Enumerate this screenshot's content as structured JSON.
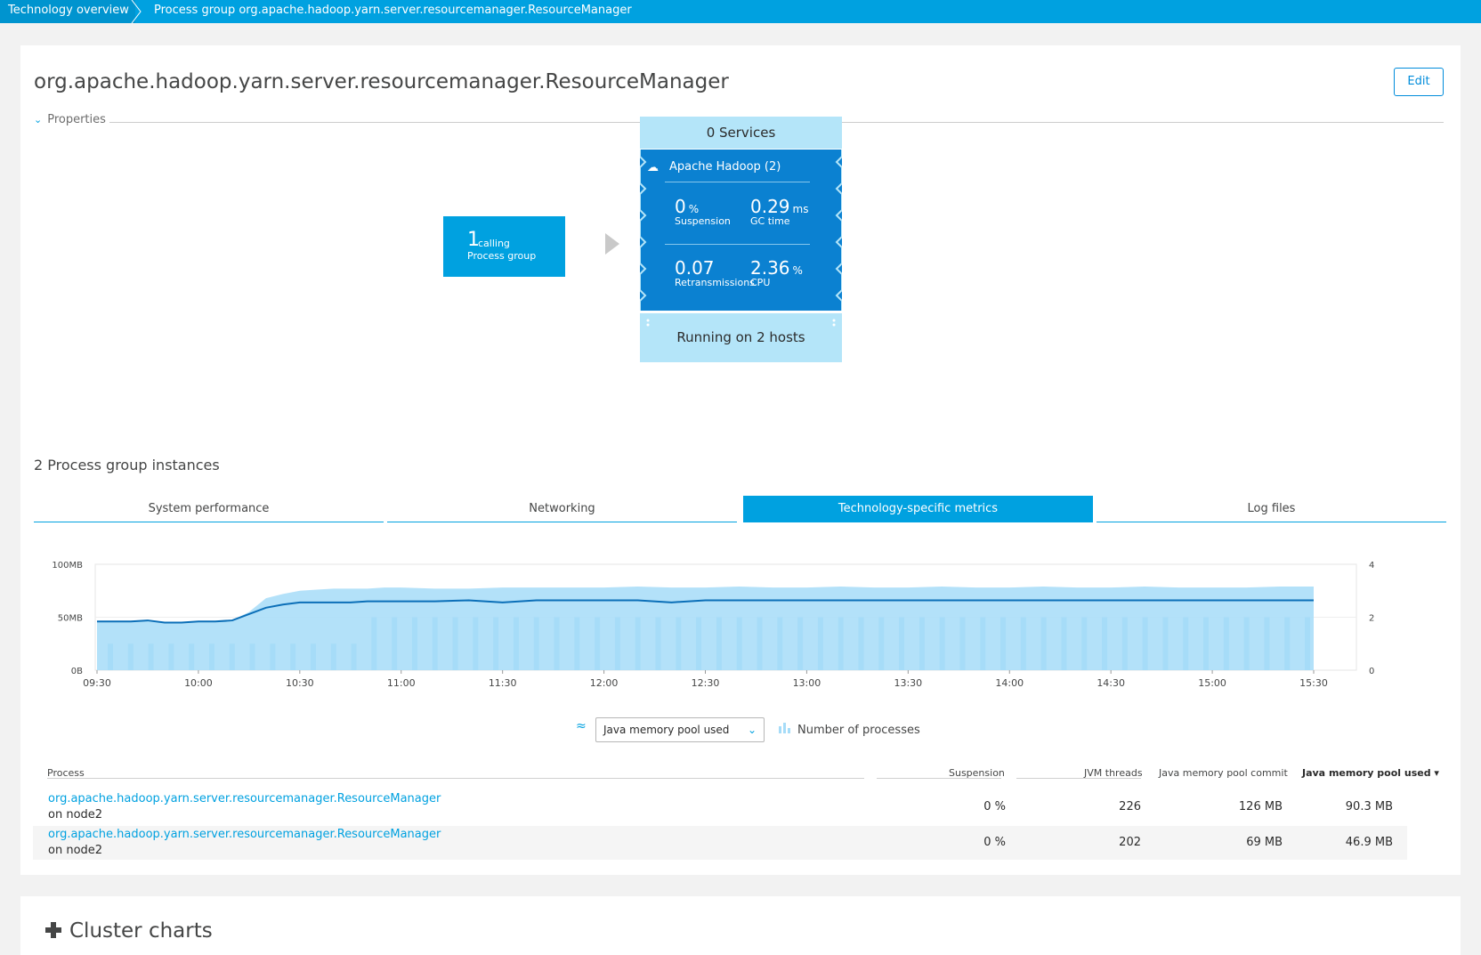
{
  "breadcrumb": {
    "items": [
      {
        "label": "Technology overview"
      },
      {
        "label": "Process group org.apache.hadoop.yarn.server.resourcemanager.ResourceManager"
      }
    ]
  },
  "header": {
    "title": "org.apache.hadoop.yarn.server.resourcemanager.ResourceManager",
    "edit_label": "Edit",
    "properties_label": "Properties"
  },
  "topology": {
    "caller": {
      "count": "1",
      "line1": "calling",
      "line2": "Process group"
    },
    "services_label": "0 Services",
    "process_group": {
      "name": "Apache Hadoop (2)",
      "icon": "hadoop-elephant-icon",
      "metrics": [
        {
          "value": "0",
          "unit": "%",
          "label": "Suspension"
        },
        {
          "value": "0.29",
          "unit": "ms",
          "label": "GC time"
        },
        {
          "value": "0.07",
          "unit": "",
          "label": "Retransmissions"
        },
        {
          "value": "2.36",
          "unit": "%",
          "label": "CPU"
        }
      ]
    },
    "hosts_label": "Running on 2 hosts"
  },
  "instances": {
    "title": "2 Process group instances",
    "tabs": [
      {
        "label": "System performance",
        "active": false
      },
      {
        "label": "Networking",
        "active": false
      },
      {
        "label": "Technology-specific metrics",
        "active": true
      },
      {
        "label": "Log files",
        "active": false
      }
    ]
  },
  "chart_data": {
    "type": "area",
    "x": [
      "09:30",
      "09:35",
      "09:40",
      "09:45",
      "09:50",
      "09:55",
      "10:00",
      "10:05",
      "10:10",
      "10:15",
      "10:20",
      "10:25",
      "10:30",
      "10:35",
      "10:40",
      "10:45",
      "10:50",
      "10:55",
      "11:00",
      "11:10",
      "11:20",
      "11:30",
      "11:40",
      "11:50",
      "12:00",
      "12:10",
      "12:20",
      "12:30",
      "12:40",
      "12:50",
      "13:00",
      "13:10",
      "13:20",
      "13:30",
      "13:40",
      "13:50",
      "14:00",
      "14:10",
      "14:20",
      "14:30",
      "14:40",
      "14:50",
      "15:00",
      "15:10",
      "15:20",
      "15:30"
    ],
    "series": [
      {
        "name": "Java memory pool commit",
        "axis": "left",
        "values": [
          46,
          46,
          46,
          47,
          45,
          45,
          46,
          46,
          47,
          55,
          68,
          72,
          75,
          76,
          77,
          77,
          77,
          78,
          78,
          77,
          77,
          78,
          78,
          78,
          78,
          79,
          78,
          78,
          79,
          78,
          78,
          79,
          78,
          78,
          79,
          78,
          78,
          79,
          78,
          78,
          79,
          78,
          78,
          78,
          79,
          79
        ]
      },
      {
        "name": "Java memory pool used",
        "axis": "left",
        "values": [
          46,
          46,
          46,
          47,
          45,
          45,
          46,
          46,
          47,
          53,
          59,
          62,
          64,
          64,
          64,
          64,
          65,
          65,
          65,
          65,
          66,
          64,
          66,
          66,
          66,
          66,
          64,
          66,
          66,
          66,
          66,
          66,
          66,
          66,
          66,
          66,
          66,
          66,
          66,
          66,
          66,
          66,
          66,
          66,
          66,
          66
        ]
      },
      {
        "name": "Number of processes",
        "axis": "right",
        "type": "bar",
        "values": [
          1,
          1,
          1,
          1,
          1,
          1,
          1,
          1,
          1,
          1,
          2,
          2,
          2,
          2,
          2,
          2,
          2,
          2,
          2,
          2,
          2,
          2,
          2,
          2,
          2,
          2,
          2,
          2,
          2,
          2,
          2,
          2,
          2,
          2,
          2,
          2,
          2,
          2,
          2,
          2,
          2,
          2,
          2,
          2,
          2,
          2
        ]
      }
    ],
    "x_ticks": [
      "09:30",
      "10:00",
      "10:30",
      "11:00",
      "11:30",
      "12:00",
      "12:30",
      "13:00",
      "13:30",
      "14:00",
      "14:30",
      "15:00",
      "15:30"
    ],
    "y_ticks_left": [
      "100MB",
      "50MB",
      "0B"
    ],
    "y_ticks_right": [
      "4",
      "2",
      "0"
    ],
    "ylim_left": [
      0,
      100
    ],
    "ylim_right": [
      0,
      4
    ],
    "selector_label": "Java memory pool used",
    "bars_legend_label": "Number of processes",
    "colors": {
      "area": "#a6dcf8",
      "line": "#0b6fb8",
      "bars": "#a6dcf8"
    }
  },
  "table": {
    "columns": [
      "Process",
      "Suspension",
      "JVM threads",
      "Java memory pool commit",
      "Java memory pool used ▾"
    ],
    "rows": [
      {
        "process": "org.apache.hadoop.yarn.server.resourcemanager.ResourceManager",
        "host": "on node2",
        "suspension": "0 %",
        "threads": "226",
        "commit": "126 MB",
        "used": "90.3 MB"
      },
      {
        "process": "org.apache.hadoop.yarn.server.resourcemanager.ResourceManager",
        "host": "on node2",
        "suspension": "0 %",
        "threads": "202",
        "commit": "69 MB",
        "used": "46.9 MB"
      }
    ]
  },
  "cluster": {
    "title": "Cluster charts",
    "icon": "cluster-icon"
  },
  "colors": {
    "accent": "#00a1e0",
    "process_group_bg": "#0b81d1",
    "light_blue": "#b4e5f9"
  }
}
